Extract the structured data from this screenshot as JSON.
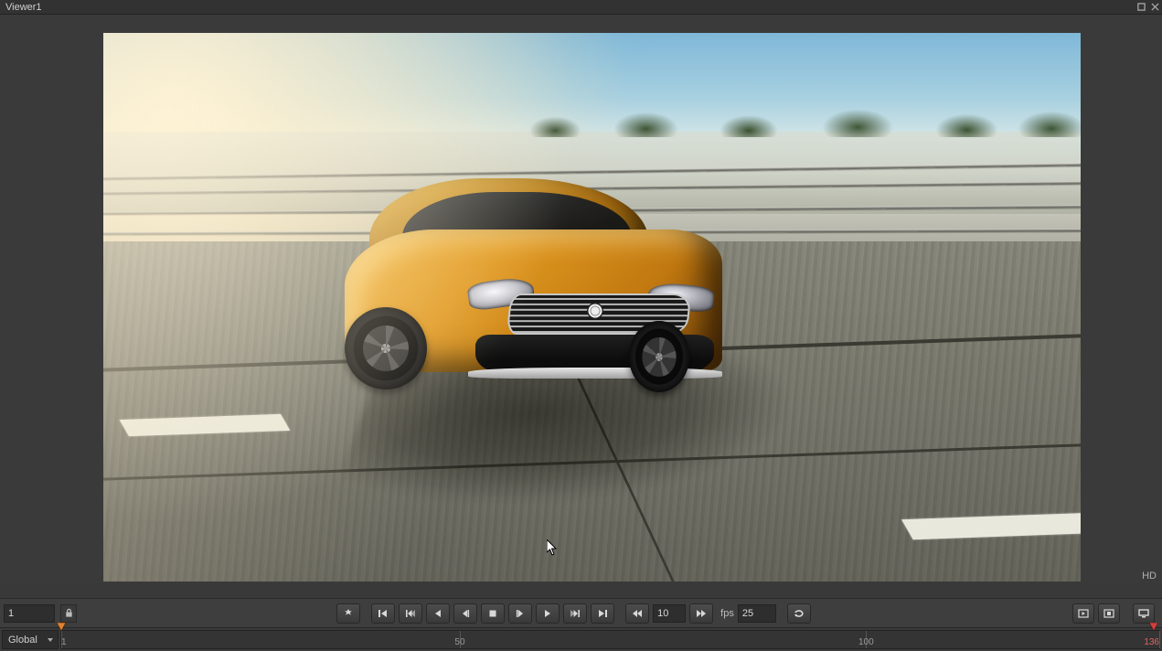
{
  "window": {
    "title": "Viewer1",
    "buttons": {
      "maximize": "maximize-icon",
      "close": "close-icon"
    }
  },
  "viewport": {
    "format_badge": "HD"
  },
  "transport": {
    "current_frame": "1",
    "skip_frames": "10",
    "fps_label": "fps",
    "fps_value": "25",
    "buttons": {
      "snapshot": "snapshot-icon",
      "first": "first-frame-icon",
      "prev_key": "prev-keyframe-icon",
      "play_rev": "play-reverse-icon",
      "step_back": "step-back-icon",
      "stop": "stop-icon",
      "step_fwd": "step-forward-icon",
      "play_fwd": "play-forward-icon",
      "next_key": "next-keyframe-icon",
      "last": "last-frame-icon",
      "skip_back": "skip-back-icon",
      "skip_fwd": "skip-forward-icon",
      "loop": "loop-icon",
      "record": "record-icon",
      "stop_rec": "stop-record-icon",
      "external": "external-icon"
    }
  },
  "timeline": {
    "mode": "Global",
    "start": 1,
    "end": 136,
    "playhead": 1,
    "ticks": [
      {
        "value": 1,
        "pos": 0.0
      },
      {
        "value": 50,
        "pos": 0.363
      },
      {
        "value": 100,
        "pos": 0.733
      },
      {
        "value": 136,
        "pos": 1.0
      }
    ],
    "end_label": "136"
  }
}
